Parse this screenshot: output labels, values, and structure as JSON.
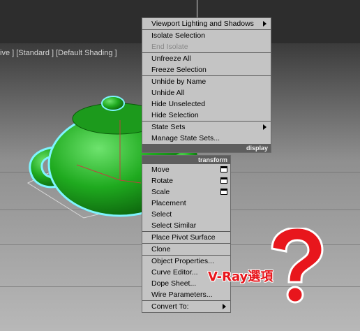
{
  "viewport": {
    "labels": "ive ] [Standard ] [Default Shading ]"
  },
  "quad_menu_top": {
    "items": [
      {
        "label": "Viewport Lighting and Shadows",
        "submenu": true
      },
      {
        "label": "Isolate Selection"
      },
      {
        "label": "End Isolate",
        "disabled": true
      },
      {
        "label": "Unfreeze All"
      },
      {
        "label": "Freeze Selection"
      },
      {
        "label": "Unhide by Name"
      },
      {
        "label": "Unhide All"
      },
      {
        "label": "Hide Unselected"
      },
      {
        "label": "Hide Selection"
      },
      {
        "label": "State Sets",
        "submenu": true
      },
      {
        "label": "Manage State Sets..."
      }
    ],
    "quad_label": "display"
  },
  "quad_menu_bottom": {
    "quad_label": "transform",
    "items": [
      {
        "label": "Move",
        "options_box": true
      },
      {
        "label": "Rotate",
        "options_box": true
      },
      {
        "label": "Scale",
        "options_box": true
      },
      {
        "label": "Placement"
      },
      {
        "label": "Select"
      },
      {
        "label": "Select Similar"
      },
      {
        "label": "Place Pivot Surface"
      },
      {
        "label": "Clone"
      },
      {
        "label": "Object Properties..."
      },
      {
        "label": "Curve Editor..."
      },
      {
        "label": "Dope Sheet..."
      },
      {
        "label": "Wire Parameters..."
      },
      {
        "label": "Convert To:",
        "submenu": true
      }
    ]
  },
  "annotation": {
    "text": "V-Ray選項",
    "color": "#e8161c"
  },
  "colors": {
    "teapot": "#1faa1f",
    "selection_outline": "#7ff4ff",
    "menu_bg": "#c4c4c4",
    "quad_label_bg": "#5e5e5e"
  }
}
